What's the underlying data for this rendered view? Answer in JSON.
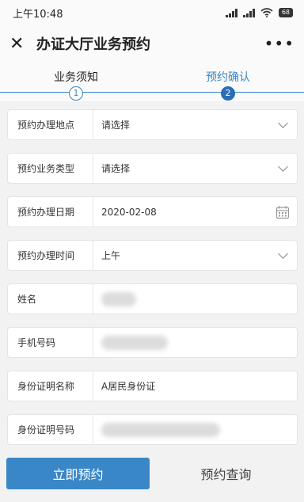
{
  "status": {
    "time": "上午10:48",
    "battery": "68"
  },
  "header": {
    "title": "办证大厅业务预约"
  },
  "steps": [
    {
      "label": "业务须知",
      "num": "1"
    },
    {
      "label": "预约确认",
      "num": "2"
    }
  ],
  "form": {
    "location": {
      "label": "预约办理地点",
      "value": "请选择"
    },
    "type": {
      "label": "预约业务类型",
      "value": "请选择"
    },
    "date": {
      "label": "预约办理日期",
      "value": "2020-02-08"
    },
    "time": {
      "label": "预约办理时间",
      "value": "上午"
    },
    "name": {
      "label": "姓名"
    },
    "phone": {
      "label": "手机号码"
    },
    "idname": {
      "label": "身份证明名称",
      "value": "A居民身份证"
    },
    "idnum": {
      "label": "身份证明号码"
    }
  },
  "actions": {
    "submit": "立即预约",
    "query": "预约查询"
  }
}
